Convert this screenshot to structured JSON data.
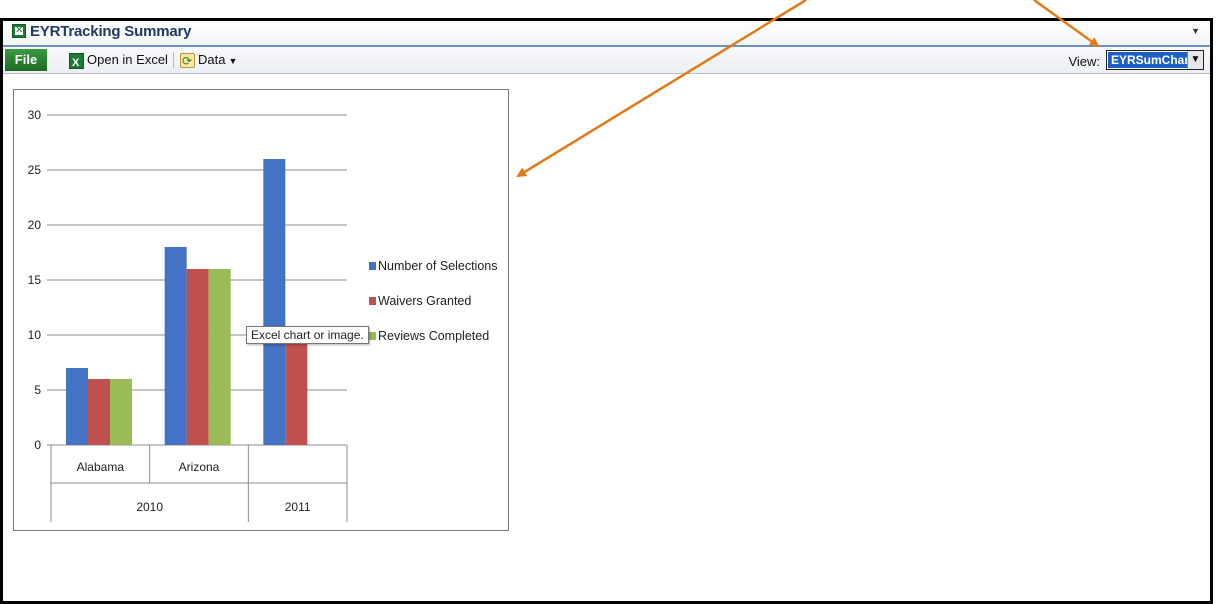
{
  "app": {
    "title": "EYRTracking Summary"
  },
  "toolbar": {
    "file_label": "File",
    "open_excel_label": "Open in Excel",
    "data_label": "Data",
    "view_label": "View:",
    "view_value": "EYRSumChart"
  },
  "tooltip": "Excel chart or image.",
  "colors": {
    "series_1": "#4472c4",
    "series_2": "#c0504d",
    "series_3": "#9bbb59",
    "annotation_arrow": "#e07b1a",
    "file_tab": "#2e8b37",
    "view_highlight": "#1b5fc7"
  },
  "chart_data": {
    "type": "bar",
    "categories": [
      {
        "label": "Alabama",
        "group": "2010"
      },
      {
        "label": "Arizona",
        "group": "2010"
      },
      {
        "label": "",
        "group": "2011"
      }
    ],
    "groups": [
      "2010",
      "2011"
    ],
    "series": [
      {
        "name": "Number of Selections",
        "values": [
          7,
          18,
          26
        ]
      },
      {
        "name": "Waivers Granted",
        "values": [
          6,
          16,
          10
        ]
      },
      {
        "name": "Reviews Completed",
        "values": [
          6,
          16,
          null
        ]
      }
    ],
    "ylim": [
      0,
      30
    ],
    "yticks": [
      0,
      5,
      10,
      15,
      20,
      25,
      30
    ],
    "grid": true,
    "legend_position": "right"
  }
}
